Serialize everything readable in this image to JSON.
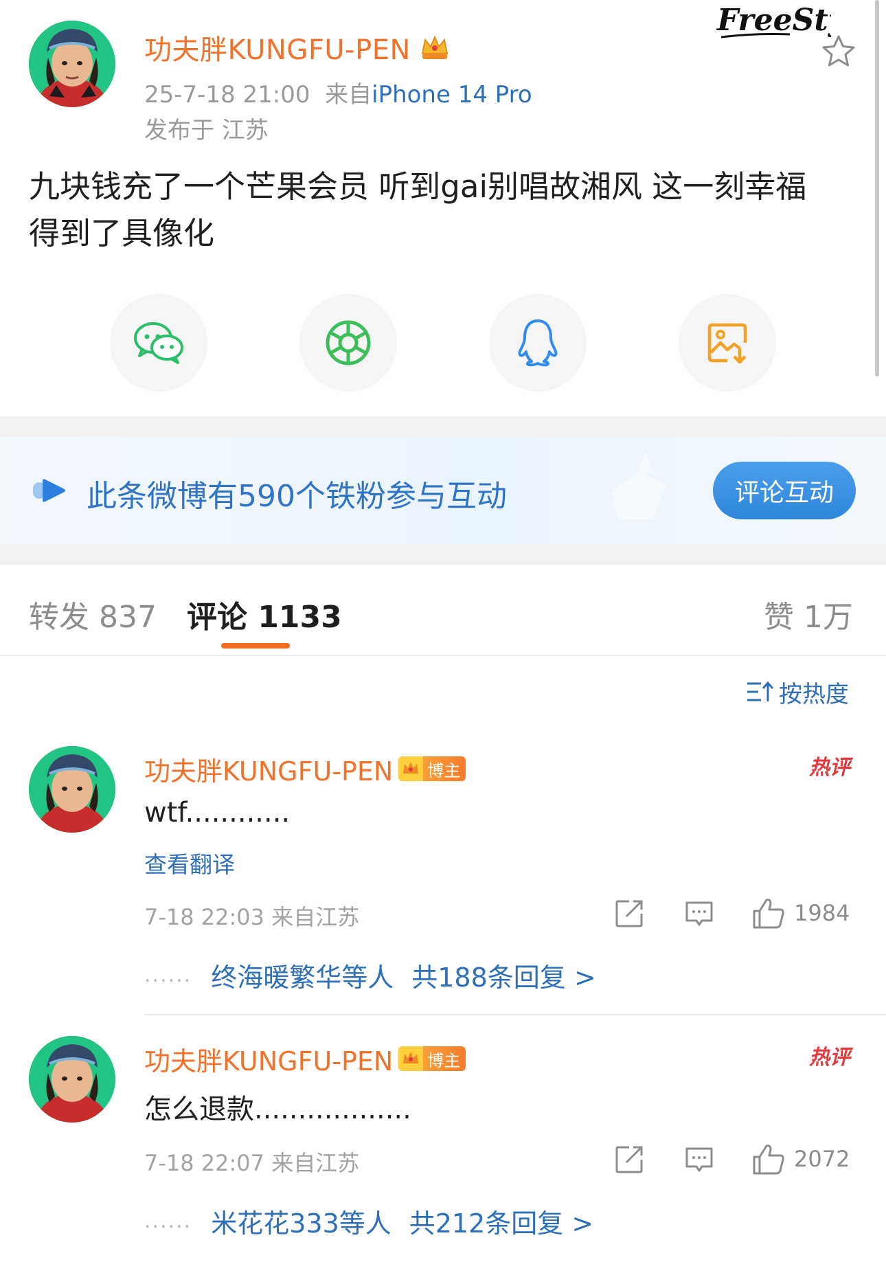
{
  "watermark": "FreeStyle",
  "post": {
    "author": "功夫胖KUNGFU-PEN",
    "time": "25-7-18 21:00",
    "from_prefix": "来自",
    "device": "iPhone 14 Pro",
    "location": "发布于 江苏",
    "text_line1": "九块钱充了一个芒果会员 听到gai别唱故湘风 这一刻幸福",
    "text_line2": "得到了具像化"
  },
  "share": {
    "icons": [
      "wechat-icon",
      "moments-icon",
      "qq-icon",
      "save-image-icon"
    ],
    "colors": {
      "wechat": "#2bbf6a",
      "moments": "#3cbf5a",
      "qq": "#2f8bf0",
      "save": "#f2a126"
    }
  },
  "fan_banner": {
    "text": "此条微博有590个铁粉参与互动",
    "button": "评论互动"
  },
  "tabs": {
    "repost": "转发 837",
    "comment": "评论 1133",
    "like": "赞 1万"
  },
  "sort": {
    "label": "按热度"
  },
  "comments": [
    {
      "author": "功夫胖KUNGFU-PEN",
      "badge": "博主",
      "hot": "热评",
      "text": "wtf............",
      "translate": "查看翻译",
      "meta": "7-18 22:03 来自江苏",
      "likes": "1984",
      "dots": "......",
      "reply_users": "终海暖繁华等人",
      "reply_count": "共188条回复 >"
    },
    {
      "author": "功夫胖KUNGFU-PEN",
      "badge": "博主",
      "hot": "热评",
      "text": "怎么退款..................",
      "meta": "7-18 22:07 来自江苏",
      "likes": "2072",
      "dots": "......",
      "reply_users": "米花花333等人",
      "reply_count": "共212条回复 >"
    }
  ],
  "colors": {
    "accent_orange": "#f2722b",
    "link_blue": "#2d6fb8",
    "tab_underline": "#f26d22",
    "hot_red": "#e4393c"
  }
}
